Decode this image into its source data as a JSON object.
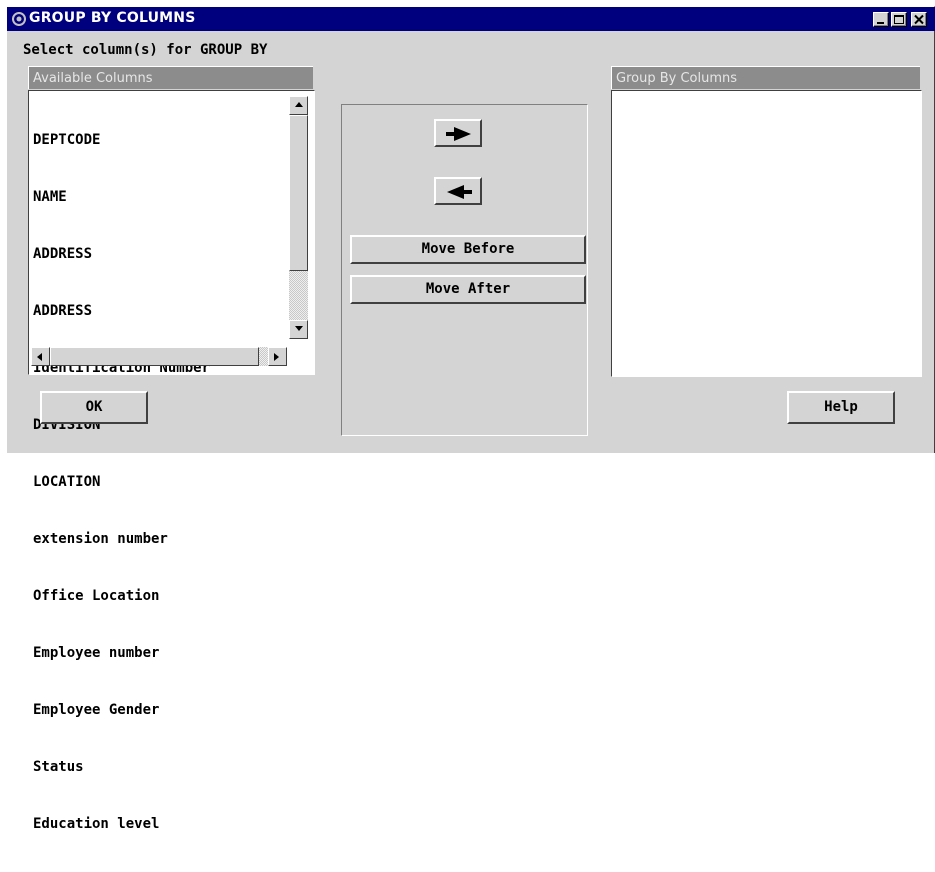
{
  "window": {
    "title": "GROUP BY COLUMNS",
    "minimize_icon": "minimize-icon",
    "maximize_icon": "maximize-icon",
    "close_icon": "close-icon"
  },
  "instruction": "Select column(s) for GROUP BY",
  "available": {
    "header": "Available Columns",
    "items": [
      "DEPTCODE",
      "NAME",
      "ADDRESS",
      "ADDRESS",
      "Identification Number",
      "DIVISION",
      "LOCATION",
      "extension number",
      "Office Location",
      "Employee number",
      "Employee Gender",
      "Status",
      "Education level"
    ]
  },
  "group_by": {
    "header": "Group By Columns",
    "items": []
  },
  "buttons": {
    "add_icon": "right-arrow-icon",
    "remove_icon": "left-arrow-icon",
    "move_before": "Move Before",
    "move_after": "Move After",
    "ok": "OK",
    "help": "Help"
  },
  "colors": {
    "titlebar": "#00007f",
    "face": "#d4d4d4",
    "pane_header": "#8c8c8c"
  }
}
